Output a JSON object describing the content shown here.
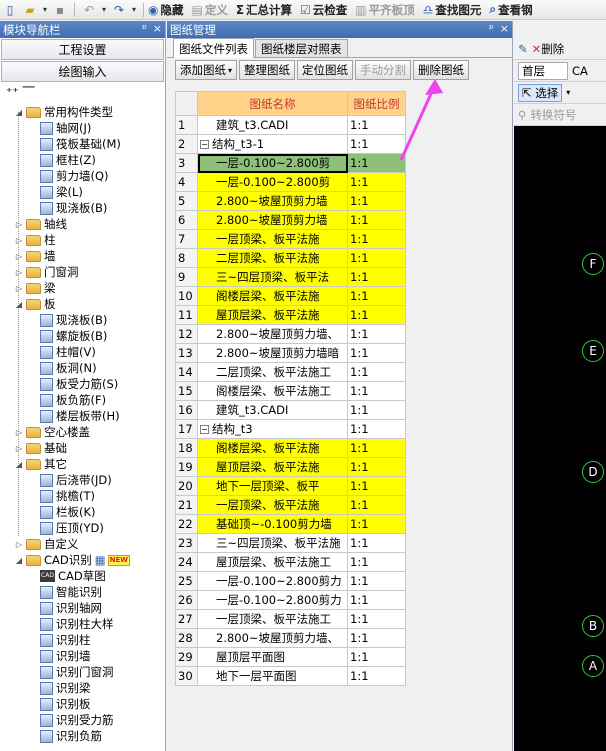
{
  "toolbar": {
    "hide": "隐藏",
    "define": "定义",
    "summary": "汇总计算",
    "cloud_check": "云检查",
    "flush": "平齐板顶",
    "find": "查找图元",
    "view": "查看钢"
  },
  "left_panel": {
    "title": "模块导航栏",
    "pin": "ᵖ",
    "close": "×",
    "btn_project": "工程设置",
    "btn_drawing": "绘图输入",
    "tree": {
      "common": "常用构件类型",
      "grid": "轴网(J)",
      "raft": "筏板基础(M)",
      "col_frame": "框柱(Z)",
      "shear_wall": "剪力墙(Q)",
      "beam": "梁(L)",
      "slab_cast": "现浇板(B)",
      "axis": "轴线",
      "column": "柱",
      "wall": "墙",
      "door": "门窗洞",
      "beam_group": "梁",
      "slab": "板",
      "slab_cast2": "现浇板(B)",
      "spiral": "螺旋板(B)",
      "cap": "柱帽(V)",
      "hole": "板洞(N)",
      "rebar_force": "板受力筋(S)",
      "rebar_neg": "板负筋(F)",
      "floor_strip": "楼层板带(H)",
      "hollow": "空心楼盖",
      "foundation": "基础",
      "other": "其它",
      "post_strip": "后浇带(JD)",
      "eave": "挑檐(T)",
      "rail": "栏板(K)",
      "top": "压顶(YD)",
      "custom": "自定义",
      "cad": "CAD识别",
      "new": "NEW",
      "cad_draft": "CAD草图",
      "smart": "智能识别",
      "id_grid": "识别轴网",
      "id_col_detail": "识别柱大样",
      "id_col": "识别柱",
      "id_wall": "识别墙",
      "id_door": "识别门窗洞",
      "id_beam": "识别梁",
      "id_slab": "识别板",
      "id_rebar": "识别受力筋",
      "id_neg": "识别负筋"
    }
  },
  "mid_panel": {
    "title": "图纸管理",
    "tab_list": "图纸文件列表",
    "tab_floor": "图纸楼层对照表",
    "btn_add": "添加图纸",
    "btn_arrange": "整理图纸",
    "btn_locate": "定位图纸",
    "btn_split": "手动分割",
    "btn_delete": "删除图纸",
    "col_name": "图纸名称",
    "col_scale": "图纸比例",
    "rows": [
      {
        "n": "1",
        "name": "建筑_t3.CADI",
        "scale": "1:1"
      },
      {
        "n": "2",
        "name": "结构_t3-1",
        "scale": "1:1"
      },
      {
        "n": "3",
        "name": "一层-0.100~2.800剪",
        "scale": "1:1"
      },
      {
        "n": "4",
        "name": "一层-0.100~2.800剪",
        "scale": "1:1"
      },
      {
        "n": "5",
        "name": "2.800~坡屋顶剪力墙",
        "scale": "1:1"
      },
      {
        "n": "6",
        "name": "2.800~坡屋顶剪力墙",
        "scale": "1:1"
      },
      {
        "n": "7",
        "name": "一层顶梁、板平法施",
        "scale": "1:1"
      },
      {
        "n": "8",
        "name": "二层顶梁、板平法施",
        "scale": "1:1"
      },
      {
        "n": "9",
        "name": "三~四层顶梁、板平法",
        "scale": "1:1"
      },
      {
        "n": "10",
        "name": "阁楼层梁、板平法施",
        "scale": "1:1"
      },
      {
        "n": "11",
        "name": "屋顶层梁、板平法施",
        "scale": "1:1"
      },
      {
        "n": "12",
        "name": "2.800~坡屋顶剪力墙、",
        "scale": "1:1"
      },
      {
        "n": "13",
        "name": "2.800~坡屋顶剪力墙暗",
        "scale": "1:1"
      },
      {
        "n": "14",
        "name": "二层顶梁、板平法施工",
        "scale": "1:1"
      },
      {
        "n": "15",
        "name": "阁楼层梁、板平法施工",
        "scale": "1:1"
      },
      {
        "n": "16",
        "name": "建筑_t3.CADI",
        "scale": "1:1"
      },
      {
        "n": "17",
        "name": "结构_t3",
        "scale": "1:1"
      },
      {
        "n": "18",
        "name": "阁楼层梁、板平法施",
        "scale": "1:1"
      },
      {
        "n": "19",
        "name": "屋顶层梁、板平法施",
        "scale": "1:1"
      },
      {
        "n": "20",
        "name": "地下一层顶梁、板平",
        "scale": "1:1"
      },
      {
        "n": "21",
        "name": "一层顶梁、板平法施",
        "scale": "1:1"
      },
      {
        "n": "22",
        "name": "基础顶~-0.100剪力墙",
        "scale": "1:1"
      },
      {
        "n": "23",
        "name": "三~四层顶梁、板平法施",
        "scale": "1:1"
      },
      {
        "n": "24",
        "name": "屋顶层梁、板平法施工",
        "scale": "1:1"
      },
      {
        "n": "25",
        "name": "一层-0.100~2.800剪力",
        "scale": "1:1"
      },
      {
        "n": "26",
        "name": "一层-0.100~2.800剪力",
        "scale": "1:1"
      },
      {
        "n": "27",
        "name": "一层顶梁、板平法施工",
        "scale": "1:1"
      },
      {
        "n": "28",
        "name": "2.800~坡屋顶剪力墙、",
        "scale": "1:1"
      },
      {
        "n": "29",
        "name": "屋顶层平面图",
        "scale": "1:1"
      },
      {
        "n": "30",
        "name": "地下一层平面图",
        "scale": "1:1"
      }
    ]
  },
  "right_panel": {
    "delete": "删除",
    "floor": "首层",
    "ca": "CA",
    "select": "选择",
    "convert": "转换符号",
    "axes": [
      "F",
      "E",
      "D",
      "B",
      "A"
    ]
  },
  "colors": {
    "highlight": "#ffff00",
    "selected": "#8fc07a",
    "arrow": "#ee44ee",
    "axis": "#37c837"
  }
}
